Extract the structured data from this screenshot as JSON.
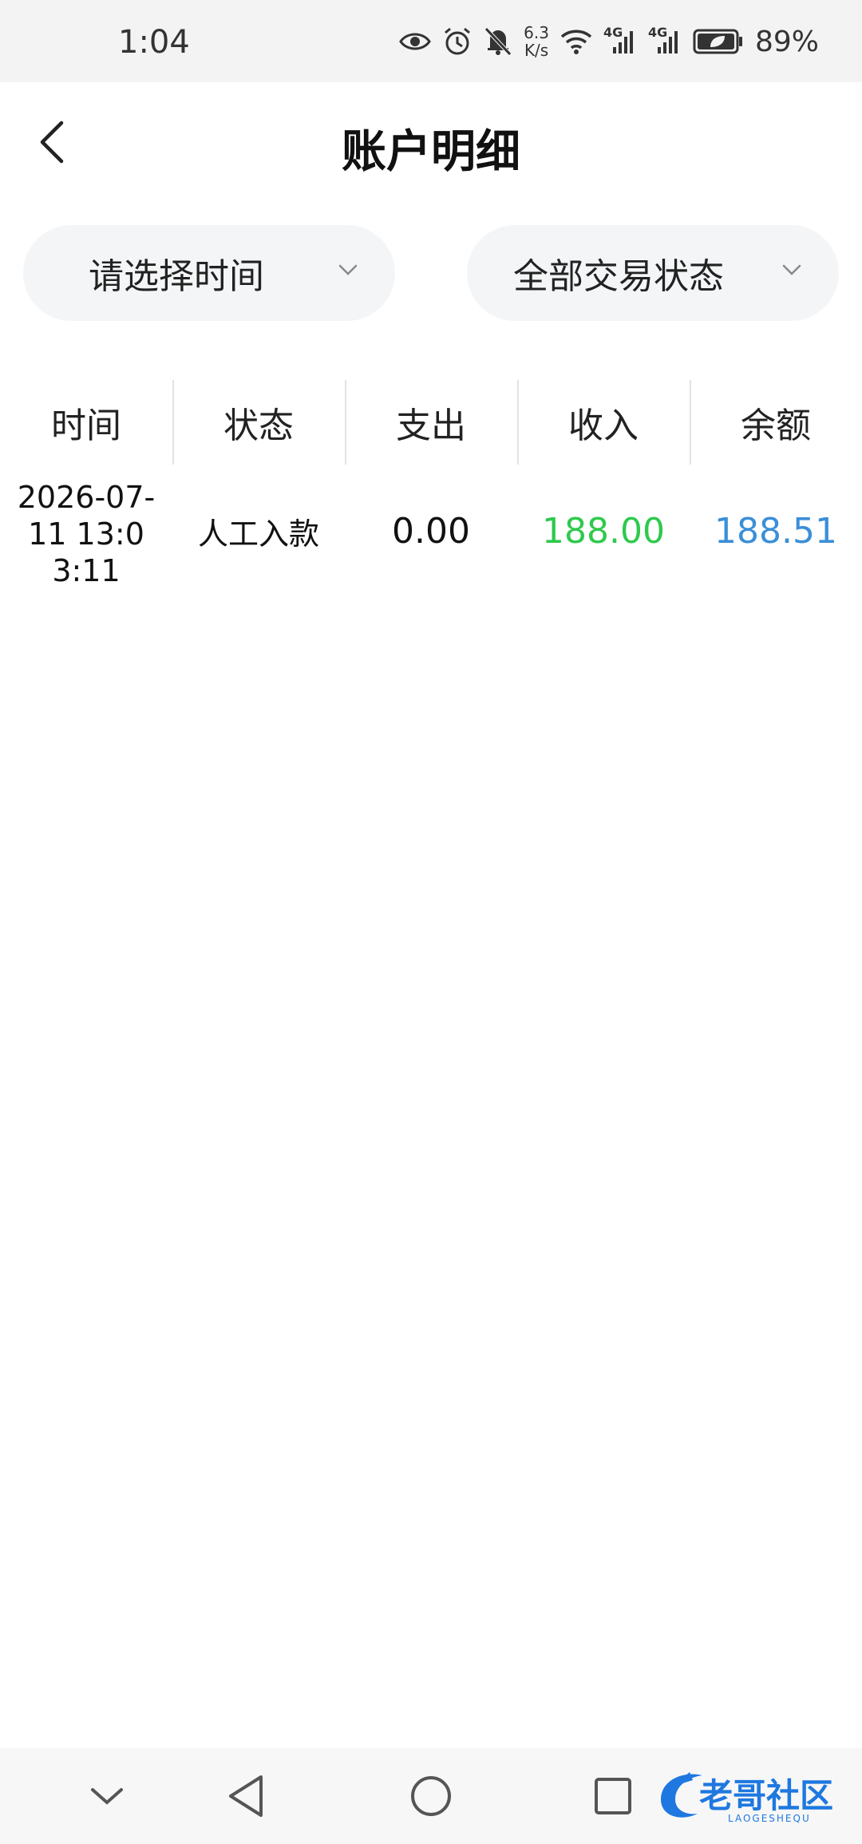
{
  "status_bar": {
    "time": "1:04",
    "net_speed_value": "6.3",
    "net_speed_unit": "K/s",
    "signal_label_1": "4G",
    "signal_label_2": "4G",
    "battery_percent": "89%",
    "icons": [
      "eye-icon",
      "alarm-icon",
      "mute-bell-icon",
      "wifi-icon",
      "signal-icon",
      "signal-icon",
      "battery-icon"
    ]
  },
  "header": {
    "title": "账户明细",
    "back_icon": "chevron-left-icon"
  },
  "filters": {
    "time": {
      "label": "请选择时间",
      "icon": "chevron-down-icon"
    },
    "status": {
      "label": "全部交易状态",
      "icon": "chevron-down-icon"
    }
  },
  "table": {
    "columns": [
      "时间",
      "状态",
      "支出",
      "收入",
      "余额"
    ],
    "rows": [
      {
        "time": "2026-07-11 13:03:11",
        "status": "人工入款",
        "expense": "0.00",
        "income": "188.00",
        "balance": "188.51"
      }
    ]
  },
  "colors": {
    "income": "#2fc94e",
    "balance": "#3a8fd8",
    "filter_bg": "#f4f5f7"
  },
  "watermark": {
    "text": "老哥社区",
    "subtext": "LAOGESHEQU"
  },
  "nav_bar": {
    "icons": [
      "chevron-down-icon",
      "triangle-back-icon",
      "circle-home-icon",
      "square-recent-icon"
    ]
  }
}
